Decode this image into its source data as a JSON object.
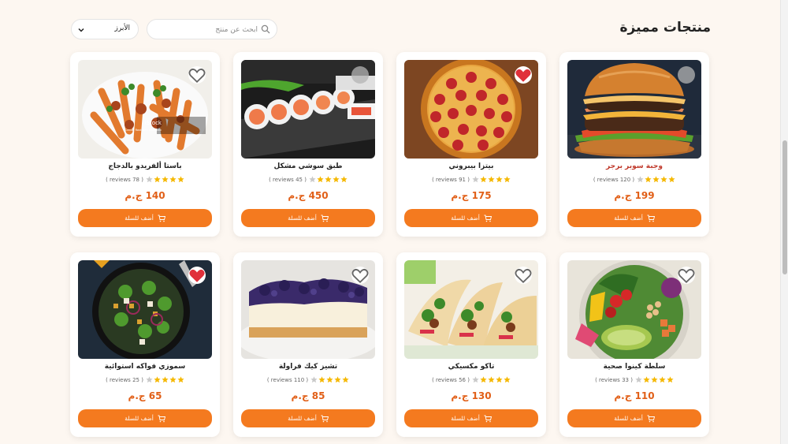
{
  "header": {
    "title": "منتجات مميزة",
    "search_placeholder": "ابحث عن منتج",
    "search_value": "",
    "sort_selected": "الأبرز"
  },
  "colors": {
    "accent": "#f47a1f",
    "price": "#e15f17",
    "star": "#f5b800",
    "favorite_active": "#e0303a",
    "page_background": "#fdf7f1"
  },
  "add_to_cart_label": "أضف للسلة",
  "products": [
    {
      "name": "وجبة سوبر برجر",
      "rating": "4.5",
      "reviews": "( 120 reviews )",
      "price": "199 ج.م",
      "favorite": "gray",
      "image": "burger"
    },
    {
      "name": "بيتزا بيبروني",
      "rating": "4.5",
      "reviews": "( 91 reviews )",
      "price": "175 ج.م",
      "favorite": "active",
      "image": "pizza"
    },
    {
      "name": "طبق سوشي مشكل",
      "rating": "4.5",
      "reviews": "( 45 reviews )",
      "price": "450 ج.م",
      "favorite": "gray",
      "image": "sushi"
    },
    {
      "name": "باستا ألفريدو بالدجاج",
      "rating": "4.5",
      "reviews": "( 78 reviews )",
      "price": "140 ج.م",
      "favorite": "outline",
      "image": "pasta"
    },
    {
      "name": "سلطة كينوا صحية",
      "rating": "4.5",
      "reviews": "( 33 reviews )",
      "price": "110 ج.م",
      "favorite": "outline",
      "image": "salad"
    },
    {
      "name": "تاكو مكسيكي",
      "rating": "4.5",
      "reviews": "( 56 reviews )",
      "price": "130 ج.م",
      "favorite": "outline",
      "image": "tacos"
    },
    {
      "name": "تشيز كيك فراولة",
      "rating": "4.5",
      "reviews": "( 110 reviews )",
      "price": "85 ج.م",
      "favorite": "outline",
      "image": "cheesecake"
    },
    {
      "name": "سموزي فواكه استوائية",
      "rating": "4.5",
      "reviews": "( 25 reviews )",
      "price": "65 ج.م",
      "favorite": "active",
      "image": "smoothie"
    }
  ],
  "photo_texts": {
    "pasta_watermark": "iStock",
    "pasta_credit": "Credit: Rostislav Sedlacek"
  }
}
